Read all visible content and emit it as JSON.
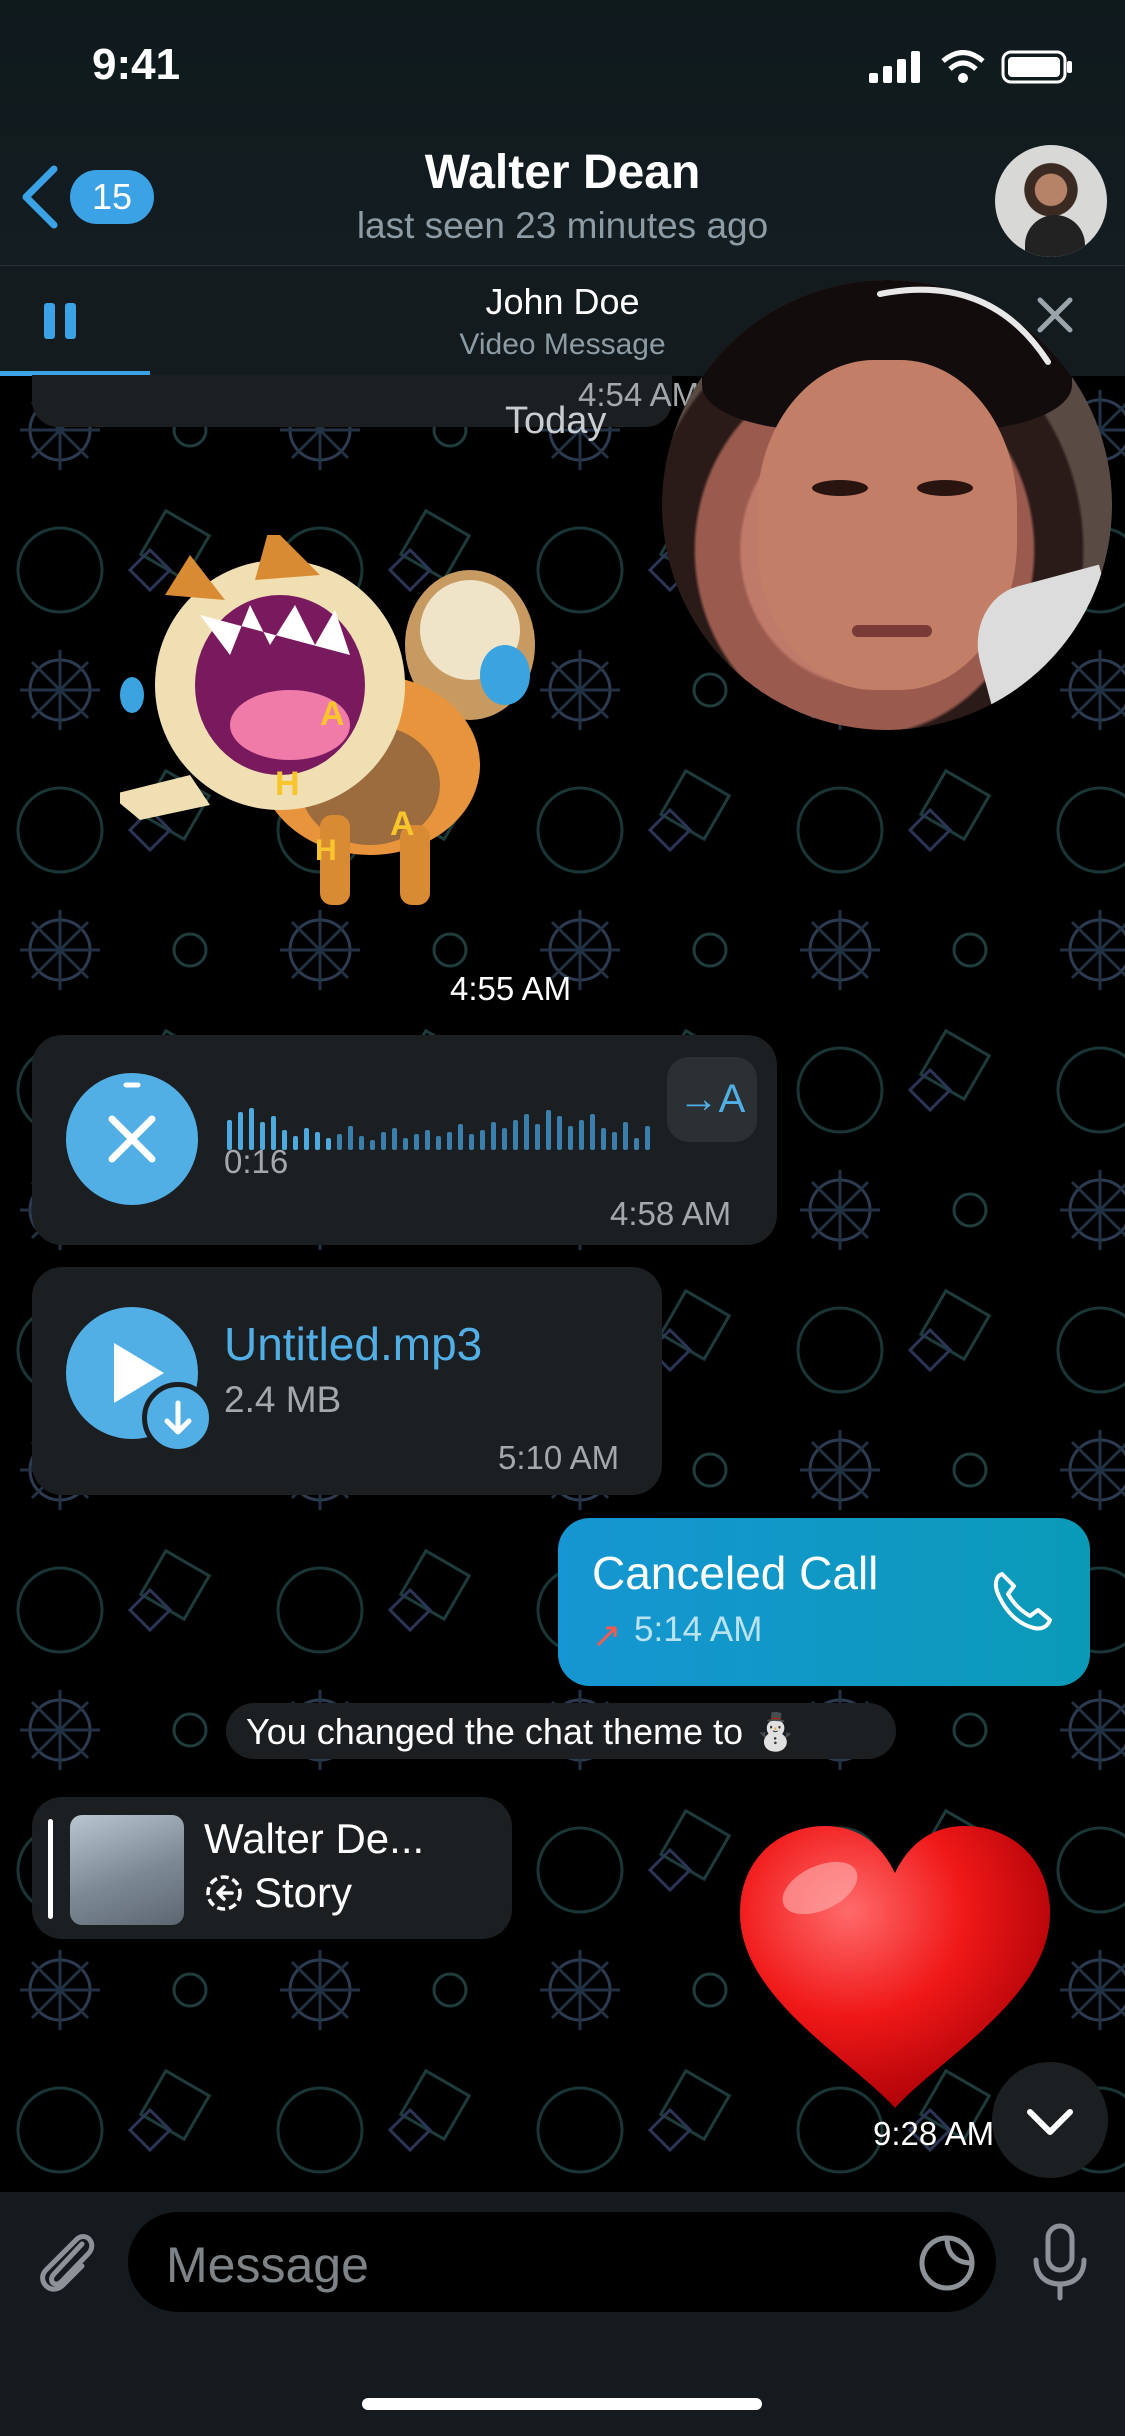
{
  "status": {
    "time": "9:41"
  },
  "header": {
    "back_count": "15",
    "title": "Walter Dean",
    "subtitle": "last seen 23 minutes ago"
  },
  "player": {
    "name": "John Doe",
    "subtitle": "Video Message"
  },
  "messages": {
    "top_partial_time": "4:54 AM",
    "date_separator": "Today",
    "sticker_time": "4:55 AM",
    "voice": {
      "duration": "0:16",
      "time": "4:58 AM",
      "translate_label": "→A"
    },
    "file": {
      "name": "Untitled.mp3",
      "size": "2.4 MB",
      "time": "5:10 AM"
    },
    "call": {
      "title": "Canceled Call",
      "arrow": "↗",
      "time": "5:14 AM"
    },
    "service": "You changed the chat theme to ⛄",
    "story": {
      "name": "Walter De...",
      "label": "Story"
    },
    "heart_time": "9:28 AM"
  },
  "input": {
    "placeholder": "Message"
  },
  "colors": {
    "accent": "#52afe6",
    "call_gradient_start": "#1696d2",
    "heart": "#e8101a"
  }
}
